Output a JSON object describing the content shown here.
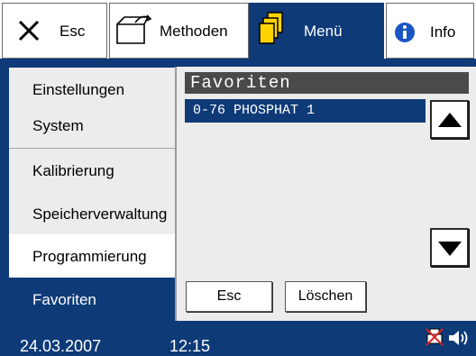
{
  "toolbar": {
    "esc_label": "Esc",
    "methods_label": "Methoden",
    "menu_label": "Menü",
    "info_label": "Info"
  },
  "menu": {
    "items": [
      {
        "label": "Einstellungen"
      },
      {
        "label": "System"
      },
      {
        "label": "Kalibrierung"
      },
      {
        "label": "Speicherverwaltung"
      },
      {
        "label": "Programmierung"
      },
      {
        "label": "Favoriten"
      }
    ],
    "selected": "Favoriten"
  },
  "favorites": {
    "title": "Favoriten",
    "items": [
      "0-76 PHOSPHAT 1"
    ],
    "esc_label": "Esc",
    "delete_label": "Löschen"
  },
  "status": {
    "date": "24.03.2007",
    "time": "12:15"
  },
  "colors": {
    "accent": "#0e3a78",
    "panel": "#ececec",
    "header": "#4a4a4a"
  }
}
